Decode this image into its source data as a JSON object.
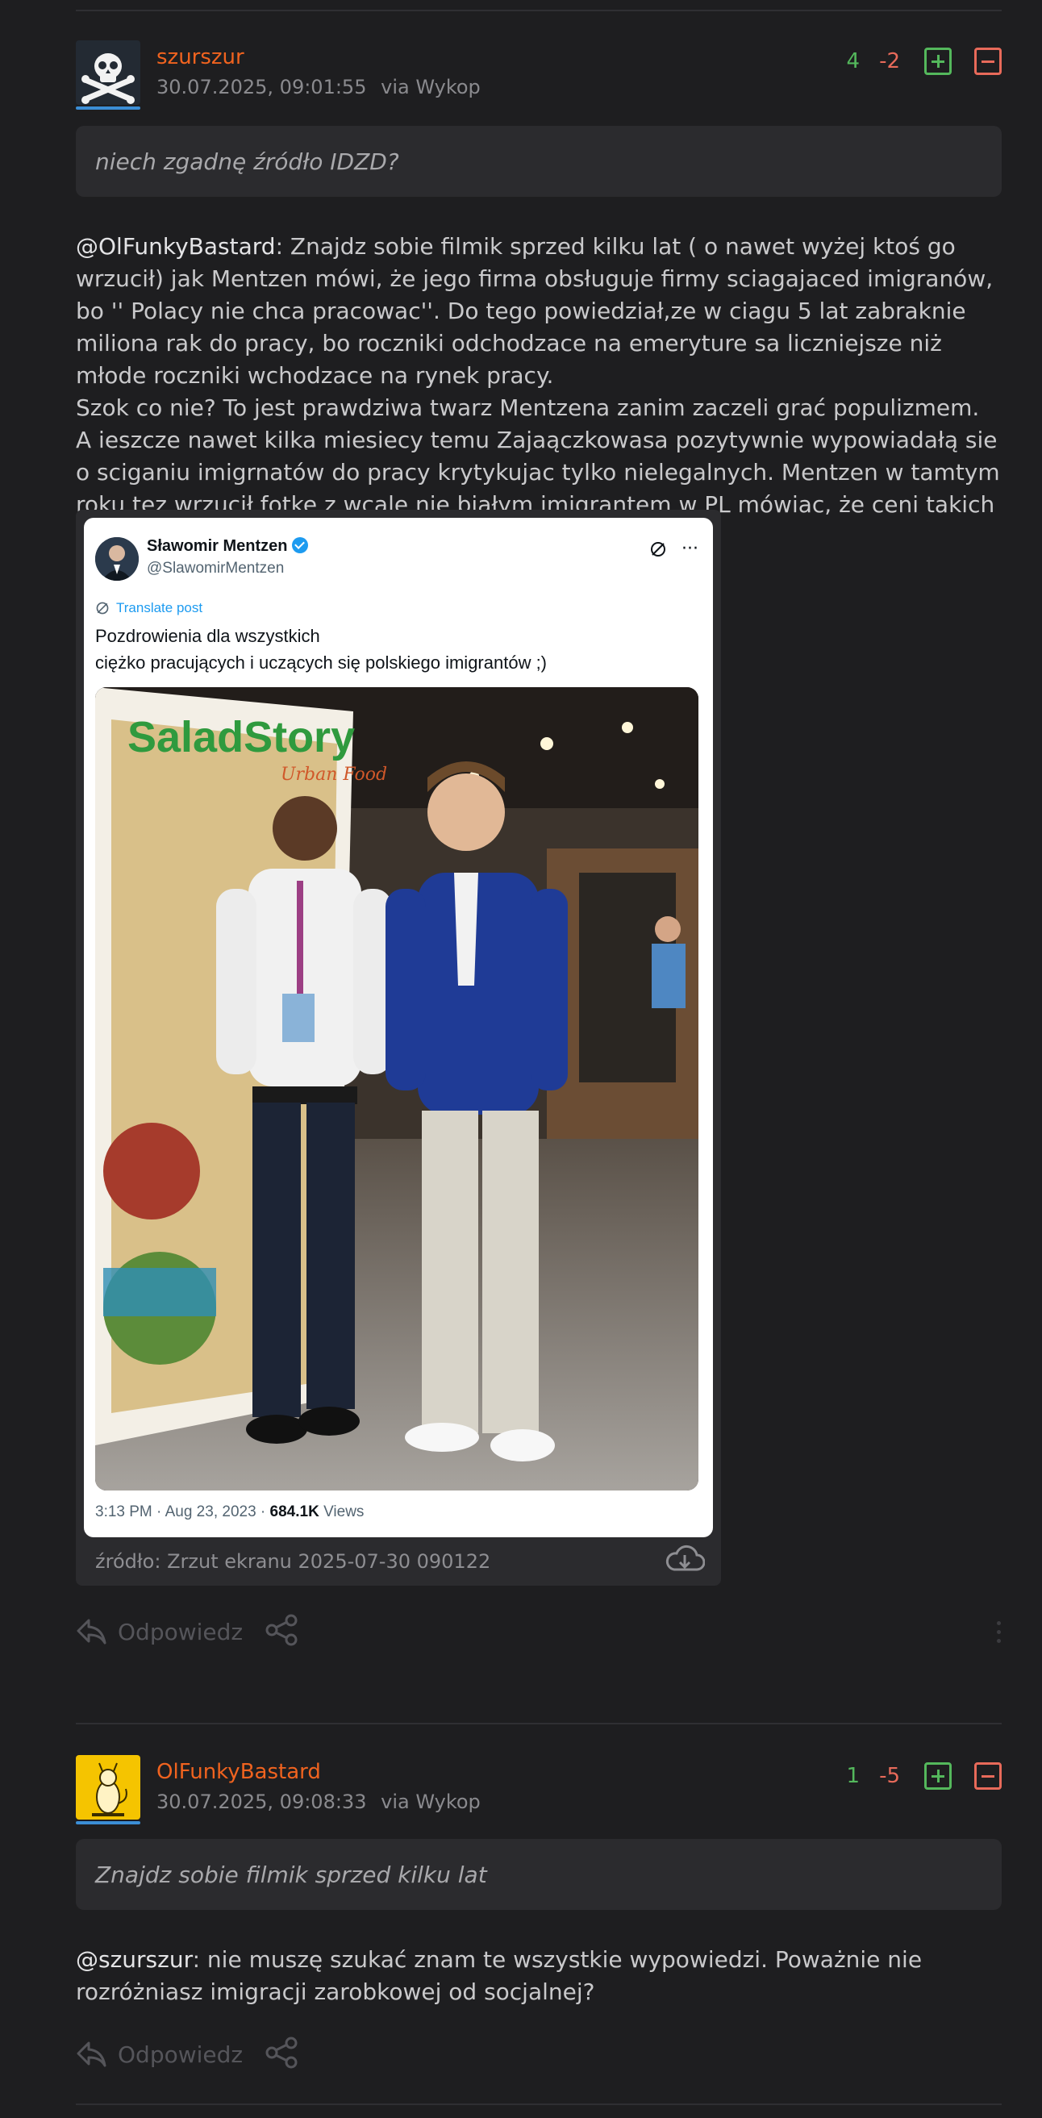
{
  "comments": [
    {
      "username": "szurszur",
      "timestamp": "30.07.2025, 09:01:55",
      "via": "via Wykop",
      "votes_plus": "4",
      "votes_minus": "-2",
      "quote": "niech zgadnę źródło IDZD?",
      "mention": "@OlFunkyBastard",
      "body": [
        ": Znajdz sobie filmik sprzed kilku lat ( o nawet wyżej ktoś go wrzucił) jak Mentzen mówi, że jego firma obsługuje firmy sciagajaced imigranów, bo '' Polacy nie chca pracowac''. Do tego powiedział,ze w ciagu 5 lat zabraknie miliona rak do pracy, bo roczniki odchodzace na emeryture sa liczniejsze niż młode roczniki wchodzace na rynek pracy.",
        "Szok co nie? To jest prawdziwa twarz Mentzena zanim zaczeli grać populizmem.",
        "A ieszcze nawet kilka miesiecy temu Zajaączkowasa pozytywnie wypowiadałą sie o sciganiu imigrnatów do pracy krytykujac tylko nielegalnych. Mentzen w tamtym roku tęz wrzucił fotke z wcale nie białym imigrantem w PL mówiac, że ceni takich ludzi."
      ],
      "media": {
        "tweet_name": "Sławomir Mentzen",
        "tweet_handle": "@SlawomirMentzen",
        "translate_label": "Translate post",
        "tweet_line1": "Pozdrowienia dla wszystkich",
        "tweet_line2": "ciężko pracujących i uczących się polskiego imigrantów ;)",
        "photo_sign": "SaladStory",
        "photo_sign_sub": "Urban Food",
        "tweet_time": "3:13 PM · Aug 23, 2023 · ",
        "tweet_views_count": "684.1K",
        "tweet_views_label": " Views",
        "caption": "źródło: Zrzut ekranu 2025-07-30 090122"
      },
      "reply_label": "Odpowiedz"
    },
    {
      "username": "OlFunkyBastard",
      "timestamp": "30.07.2025, 09:08:33",
      "via": "via Wykop",
      "votes_plus": "1",
      "votes_minus": "-5",
      "quote": "Znajdz sobie filmik sprzed kilku lat",
      "mention": "@szurszur",
      "body": [
        ": nie muszę szukać znam te wszystkie wypowiedzi. Poważnie nie rozróżniasz imigracji zarobkowej od socjalnej?"
      ],
      "reply_label": "Odpowiedz"
    }
  ],
  "colors": {
    "background": "#1e1e20",
    "username": "#f0631f",
    "vote_plus": "#54b85c",
    "vote_minus": "#e86a5a",
    "avatar_underline": "#3b8ed6"
  }
}
